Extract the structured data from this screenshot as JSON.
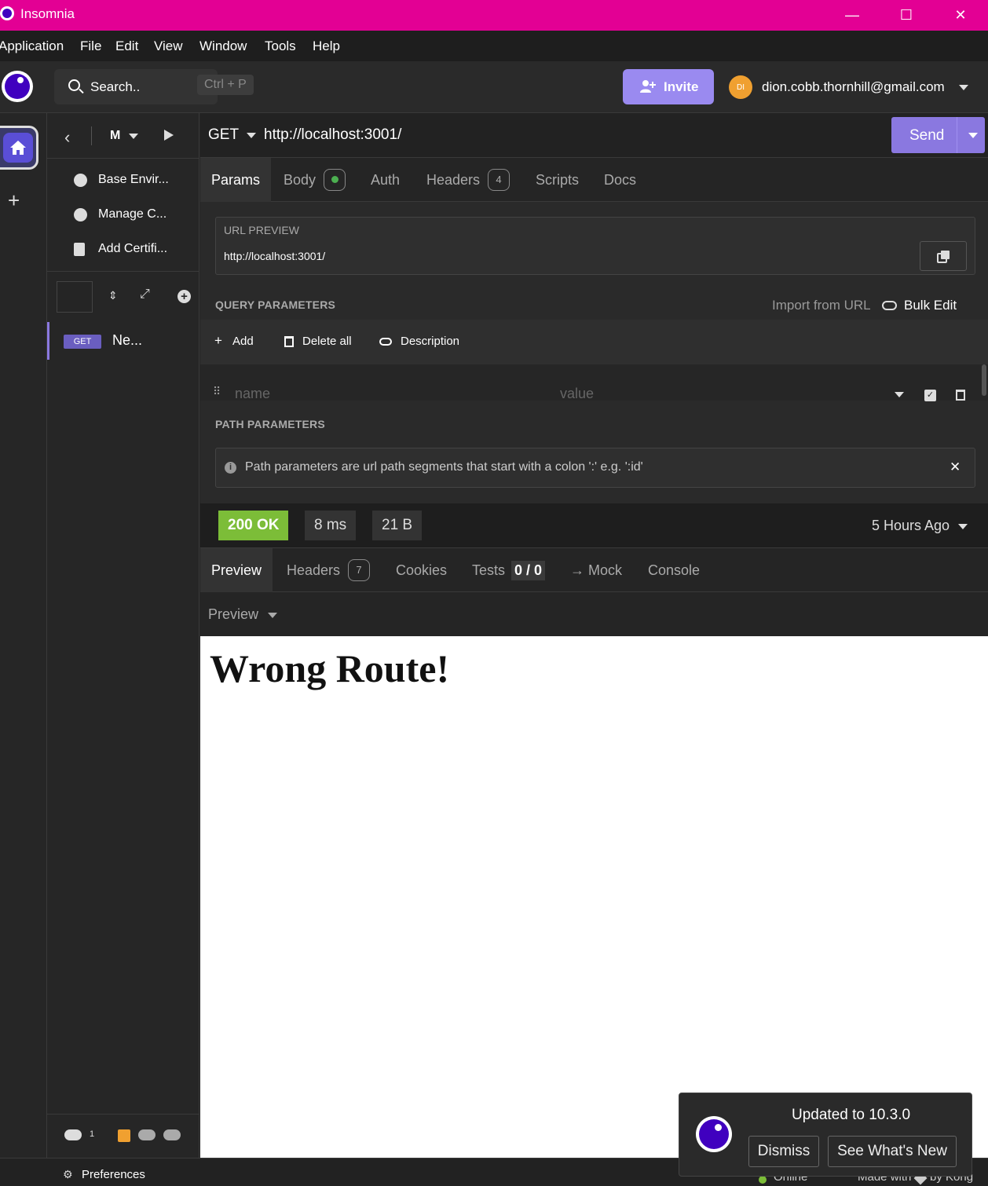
{
  "window": {
    "title": "Insomnia",
    "minimize": "—",
    "maximize": "☐",
    "close": "✕"
  },
  "menu": [
    "Application",
    "File",
    "Edit",
    "View",
    "Window",
    "Tools",
    "Help"
  ],
  "header": {
    "search_label": "Search..",
    "search_shortcut": "Ctrl + P",
    "invite_label": "Invite",
    "avatar_initials": "DI",
    "user_email": "dion.cobb.thornhill@gmail.com"
  },
  "sidebar": {
    "project_label": "M",
    "items": [
      {
        "label": "Base Envir...",
        "icon": "globe-icon"
      },
      {
        "label": "Manage C...",
        "icon": "cookie-icon"
      },
      {
        "label": "Add Certifi...",
        "icon": "certificate-icon"
      }
    ],
    "request": {
      "method": "GET",
      "name": "Ne..."
    },
    "preferences_label": "Preferences",
    "sync_count": "1"
  },
  "request": {
    "method": "GET",
    "url": "http://localhost:3001/",
    "send_label": "Send",
    "tabs": [
      {
        "label": "Params"
      },
      {
        "label": "Body"
      },
      {
        "label": "Auth"
      },
      {
        "label": "Headers",
        "badge": "4"
      },
      {
        "label": "Scripts"
      },
      {
        "label": "Docs"
      }
    ],
    "url_preview_title": "URL PREVIEW",
    "url_preview": "http://localhost:3001/",
    "query_title": "QUERY PARAMETERS",
    "import_from_url": "Import from URL",
    "bulk_edit": "Bulk Edit",
    "add_label": "Add",
    "delete_all_label": "Delete all",
    "description_label": "Description",
    "name_placeholder": "name",
    "value_placeholder": "value",
    "path_title": "PATH PARAMETERS",
    "path_info": "Path parameters are url path segments that start with a colon ':' e.g. ':id'"
  },
  "response": {
    "status": "200 OK",
    "time": "8 ms",
    "size": "21 B",
    "when": "5 Hours Ago",
    "tabs": [
      {
        "label": "Preview"
      },
      {
        "label": "Headers",
        "badge": "7"
      },
      {
        "label": "Cookies"
      },
      {
        "label": "Tests",
        "badge": "0 / 0"
      },
      {
        "label": "→ Mock"
      },
      {
        "label": "Console"
      }
    ],
    "preview_mode": "Preview",
    "body_heading": "Wrong Route!"
  },
  "toast": {
    "message": "Updated to 10.3.0",
    "dismiss": "Dismiss",
    "whats_new": "See What's New"
  },
  "footer": {
    "online": "Online",
    "made_with": "Made with",
    "by_kong": "by Kong"
  },
  "colors": {
    "titlebar": "#e30094",
    "accent": "#8a78e0",
    "status_ok": "#7cbd38",
    "brand": "#4000bf"
  }
}
